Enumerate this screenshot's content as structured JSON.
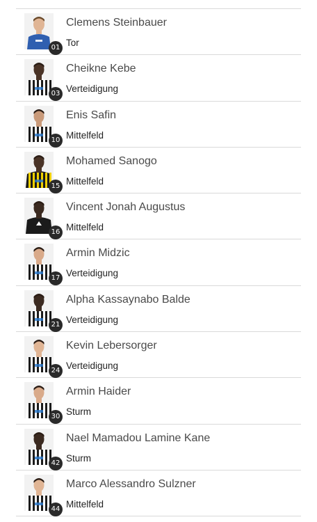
{
  "players": [
    {
      "name": "Clemens Steinbauer",
      "position": "Tor",
      "number": "01",
      "kit": "keeper-blue"
    },
    {
      "name": "Cheikne Kebe",
      "position": "Verteidigung",
      "number": "03",
      "kit": "stripes",
      "skin": "#4a3326"
    },
    {
      "name": "Enis Safin",
      "position": "Mittelfeld",
      "number": "10",
      "kit": "stripes",
      "skin": "#c99a7a"
    },
    {
      "name": "Mohamed Sanogo",
      "position": "Mittelfeld",
      "number": "15",
      "kit": "yellow-stripes",
      "skin": "#4a3326"
    },
    {
      "name": "Vincent Jonah Augustus",
      "position": "Mittelfeld",
      "number": "16",
      "kit": "black-training",
      "skin": "#3b2a20"
    },
    {
      "name": "Armin Midzic",
      "position": "Verteidigung",
      "number": "17",
      "kit": "stripes",
      "skin": "#d9aa8a"
    },
    {
      "name": "Alpha Kassaynabo Balde",
      "position": "Verteidigung",
      "number": "21",
      "kit": "stripes",
      "skin": "#3b2a20"
    },
    {
      "name": "Kevin Lebersorger",
      "position": "Verteidigung",
      "number": "24",
      "kit": "stripes",
      "skin": "#e0b595"
    },
    {
      "name": "Armin Haider",
      "position": "Sturm",
      "number": "30",
      "kit": "stripes",
      "skin": "#d9aa8a"
    },
    {
      "name": "Nael Mamadou Lamine Kane",
      "position": "Sturm",
      "number": "42",
      "kit": "stripes",
      "skin": "#3b2a20"
    },
    {
      "name": "Marco Alessandro Sulzner",
      "position": "Mittelfeld",
      "number": "44",
      "kit": "stripes",
      "skin": "#e0b595"
    }
  ]
}
